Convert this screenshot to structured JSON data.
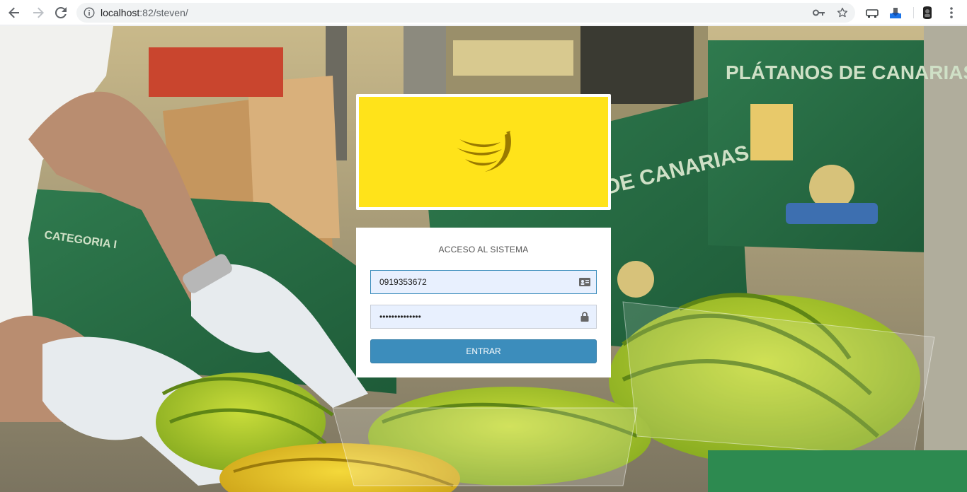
{
  "browser": {
    "url_host": "localhost",
    "url_rest": ":82/steven/",
    "icons": [
      "back-icon",
      "forward-icon",
      "reload-icon",
      "info-icon",
      "key-icon",
      "star-icon",
      "cast-icon",
      "download-ext-icon",
      "profile-icon",
      "menu-icon"
    ]
  },
  "background_text": {
    "sign_left": "PLÁTANOS DE CANARIAS",
    "sign_center": "S DE CANARIAS",
    "box_left": "CATEGORIA I"
  },
  "login": {
    "title": "ACCESO AL SISTEMA",
    "username_value": "0919353672",
    "password_value": "••••••••••••••",
    "submit_label": "ENTRAR"
  },
  "colors": {
    "logo_bg": "#ffe31a",
    "logo_mark": "#9a7a00",
    "button": "#3c8dbc",
    "field_bg": "#e8f0fe"
  }
}
